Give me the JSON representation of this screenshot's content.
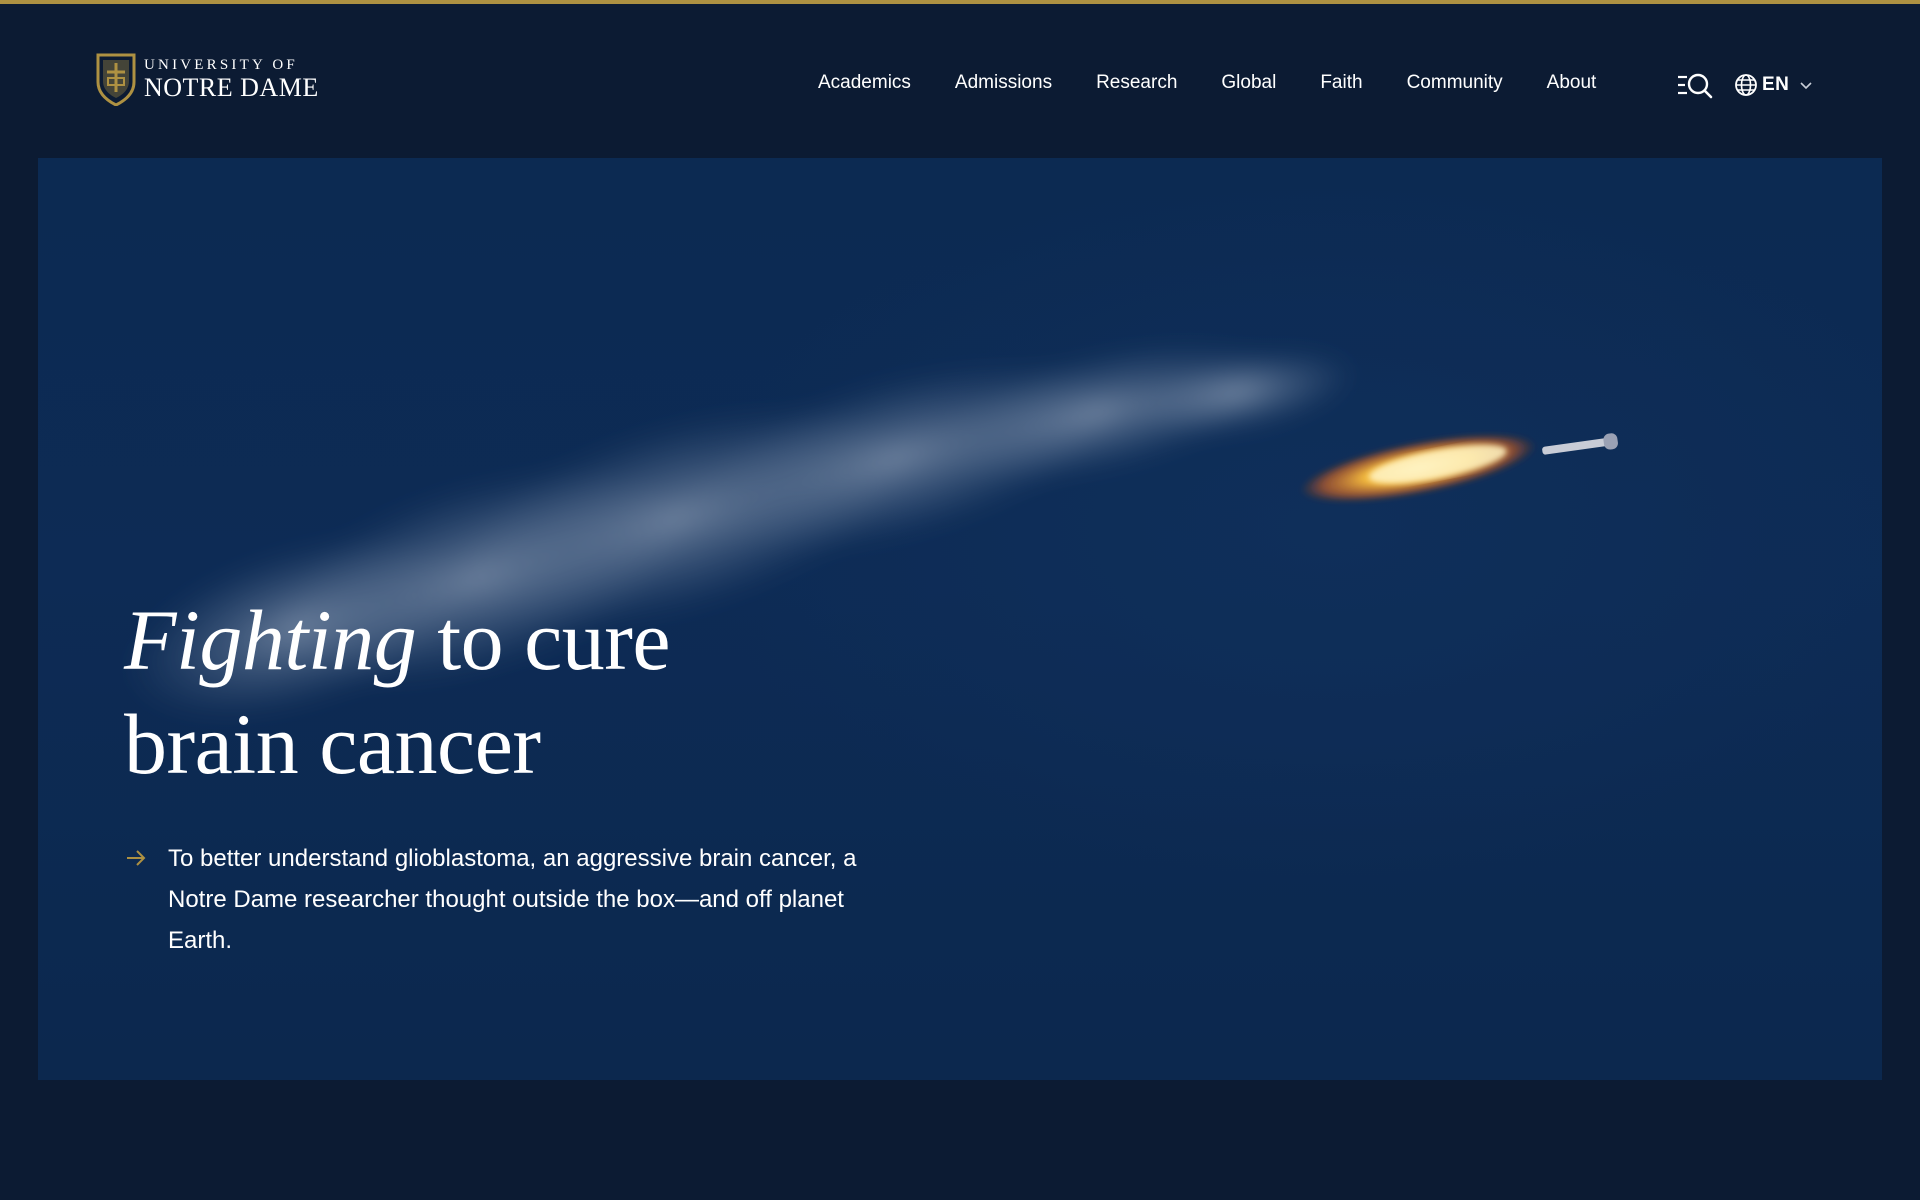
{
  "brand": {
    "line1": "UNIVERSITY OF",
    "line2": "NOTRE DAME",
    "gold": "#ae9142",
    "navy": "#0c1b33"
  },
  "nav": {
    "items": [
      {
        "label": "Academics"
      },
      {
        "label": "Admissions"
      },
      {
        "label": "Research"
      },
      {
        "label": "Global"
      },
      {
        "label": "Faith"
      },
      {
        "label": "Community"
      },
      {
        "label": "About"
      }
    ]
  },
  "tools": {
    "search_icon": "menu-search-icon",
    "language_icon": "globe-icon",
    "language_label": "EN",
    "language_chevron": "chevron-down-icon"
  },
  "hero": {
    "headline_italic": "Fighting",
    "headline_rest": " to cure",
    "headline_line2": "brain cancer",
    "summary": "To better understand glioblastoma, an aggressive brain cancer, a Notre Dame researcher thought outside the box—and off planet Earth.",
    "arrow_icon": "arrow-right-icon",
    "background": "rocket-launch-image"
  }
}
